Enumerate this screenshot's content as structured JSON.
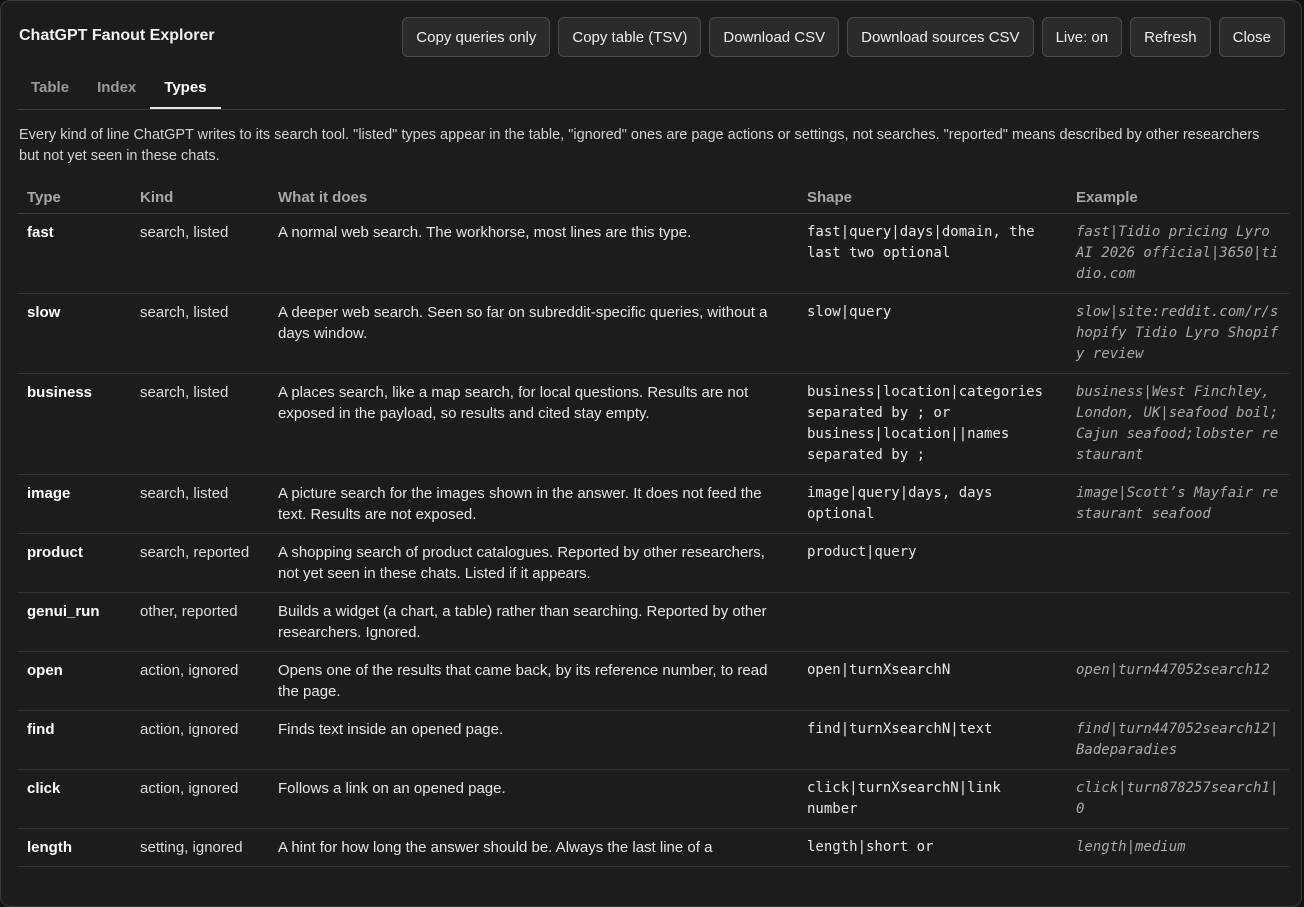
{
  "app": {
    "title": "ChatGPT Fanout Explorer"
  },
  "toolbar": {
    "copy_queries": "Copy queries only",
    "copy_table": "Copy table (TSV)",
    "download_csv": "Download CSV",
    "download_sources": "Download sources CSV",
    "live": "Live: on",
    "refresh": "Refresh",
    "close": "Close"
  },
  "tabs": [
    {
      "label": "Table",
      "active": false
    },
    {
      "label": "Index",
      "active": false
    },
    {
      "label": "Types",
      "active": true
    }
  ],
  "intro": "Every kind of line ChatGPT writes to its search tool. \"listed\" types appear in the table, \"ignored\" ones are page actions or settings, not searches. \"reported\" means described by other researchers but not yet seen in these chats.",
  "columns": {
    "type": "Type",
    "kind": "Kind",
    "what": "What it does",
    "shape": "Shape",
    "example": "Example"
  },
  "rows": [
    {
      "type": "fast",
      "kind": "search, listed",
      "what": "A normal web search. The workhorse, most lines are this type.",
      "shape": "fast|query|days|domain, the last two optional",
      "example": "fast|Tidio pricing Lyro AI 2026 official|3650|tidio.com"
    },
    {
      "type": "slow",
      "kind": "search, listed",
      "what": "A deeper web search. Seen so far on subreddit-specific queries, without a days window.",
      "shape": "slow|query",
      "example": "slow|site:reddit.com/r/shopify Tidio Lyro Shopify review"
    },
    {
      "type": "business",
      "kind": "search, listed",
      "what": "A places search, like a map search, for local questions. Results are not exposed in the payload, so results and cited stay empty.",
      "shape": "business|location|categories separated by ; or business|location||names separated by ;",
      "example": "business|West Finchley, London, UK|seafood boil;Cajun seafood;lobster restaurant"
    },
    {
      "type": "image",
      "kind": "search, listed",
      "what": "A picture search for the images shown in the answer. It does not feed the text. Results are not exposed.",
      "shape": "image|query|days, days optional",
      "example": "image|Scott’s Mayfair restaurant seafood"
    },
    {
      "type": "product",
      "kind": "search, reported",
      "what": "A shopping search of product catalogues. Reported by other researchers, not yet seen in these chats. Listed if it appears.",
      "shape": "product|query",
      "example": ""
    },
    {
      "type": "genui_run",
      "kind": "other, reported",
      "what": "Builds a widget (a chart, a table) rather than searching. Reported by other researchers. Ignored.",
      "shape": "",
      "example": ""
    },
    {
      "type": "open",
      "kind": "action, ignored",
      "what": "Opens one of the results that came back, by its reference number, to read the page.",
      "shape": "open|turnXsearchN",
      "example": "open|turn447052search12"
    },
    {
      "type": "find",
      "kind": "action, ignored",
      "what": "Finds text inside an opened page.",
      "shape": "find|turnXsearchN|text",
      "example": "find|turn447052search12|Badeparadies"
    },
    {
      "type": "click",
      "kind": "action, ignored",
      "what": "Follows a link on an opened page.",
      "shape": "click|turnXsearchN|link number",
      "example": "click|turn878257search1|0"
    },
    {
      "type": "length",
      "kind": "setting, ignored",
      "what": "A hint for how long the answer should be. Always the last line of a",
      "shape": "length|short or",
      "example": "length|medium"
    }
  ]
}
